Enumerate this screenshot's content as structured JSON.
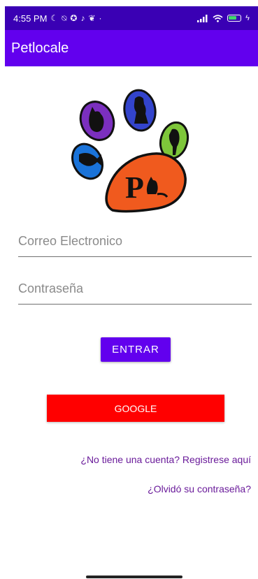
{
  "status_bar": {
    "time": "4:55 PM",
    "left_icons": [
      "moon-icon",
      "mute-icon",
      "hub-icon",
      "tiktok-icon",
      "twitter-icon"
    ],
    "right_icons": [
      "signal-icon",
      "wifi-icon",
      "battery-icon",
      "charging-icon"
    ],
    "battery_level": "56"
  },
  "app_bar": {
    "title": "Petlocale"
  },
  "login": {
    "email_placeholder": "Correo Electronico",
    "password_placeholder": "Contraseña",
    "submit_label": "ENTRAR",
    "google_label": "GOOGLE"
  },
  "links": {
    "register": "¿No tiene una cuenta? Registrese aquí",
    "forgot": "¿Olvidó su contraseña?"
  },
  "colors": {
    "status_bar": "#3a00b4",
    "primary": "#6200ee",
    "google": "#ff0000",
    "link": "#6a1b9a"
  }
}
